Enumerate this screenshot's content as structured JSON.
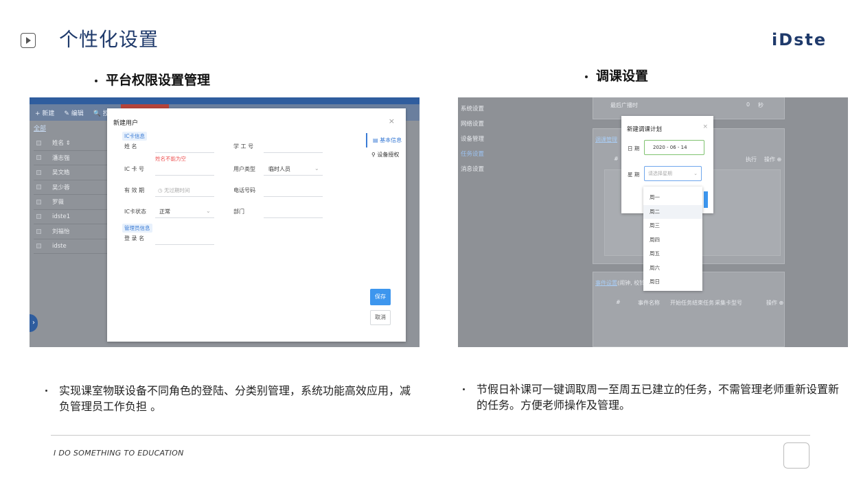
{
  "header": {
    "title": "个性化设置",
    "logo": "iDste"
  },
  "left": {
    "section_title": "平台权限设置管理",
    "screenshot": {
      "toolbar": [
        "+ 新建",
        "✎ 编辑",
        "🔍 授权"
      ],
      "tab": "全部",
      "table_header": "姓名 ⇕",
      "rows": [
        "潘志强",
        "吴文皓",
        "吴少蓉",
        "罗薇",
        "idste1",
        "刘福怡",
        "idste"
      ],
      "modal": {
        "title": "新建用户",
        "close": "×",
        "section_card": "IC卡信息",
        "section_admin": "管理员信息",
        "fields": {
          "name_label": "姓 名",
          "name_error": "姓名不能为空",
          "staff_id_label": "学 工 号",
          "card_no_label": "IC 卡 号",
          "user_type_label": "用户类型",
          "user_type_value": "临时人员",
          "validity_label": "有 效 期",
          "validity_placeholder": "无过期时间",
          "phone_label": "电话号码",
          "card_status_label": "IC卡状态",
          "card_status_value": "正常",
          "dept_label": "部门",
          "login_label": "登 录 名"
        },
        "side_nav": [
          "基本信息",
          "设备授权"
        ],
        "save": "保存",
        "cancel": "取消"
      }
    },
    "description": "实现课室物联设备不同角色的登陆、分类别管理，系统功能高效应用，减负管理员工作负担 。"
  },
  "right": {
    "section_title": "调课设置",
    "screenshot": {
      "menu": [
        "系统设置",
        "网络设置",
        "设备管理",
        "任务设置",
        "消息设置"
      ],
      "top_label": "最后广播时",
      "top_value": "0",
      "top_unit": "秒",
      "panel_link_1": "调课管理",
      "col_hash": "#",
      "col_exec": "执行",
      "col_op": "操作 ⊕",
      "panel_link_2": "事件设置",
      "panel_note": "(闹钟, 校铃,",
      "event_cols": [
        "#",
        "事件名称",
        "开始任务",
        "结束任务",
        "采集卡型号",
        "操作 ⊕"
      ],
      "modal": {
        "title": "新建调课计划",
        "close": "×",
        "date_label": "日 期",
        "date_value": "2020 - 06 - 14",
        "week_label": "星 期",
        "week_placeholder": "请选择星期"
      },
      "options": [
        "周一",
        "周二",
        "周三",
        "周四",
        "周五",
        "周六",
        "周日"
      ]
    },
    "description": "节假日补课可一键调取周一至周五已建立的任务，不需管理老师重新设置新的任务。方便老师操作及管理。"
  },
  "footer": {
    "tagline": "I DO SOMETHING TO EDUCATION"
  }
}
